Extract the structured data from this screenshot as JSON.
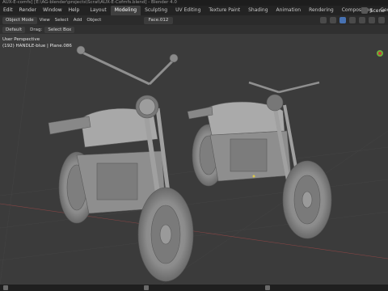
{
  "titlebar": {
    "text": "AUX-E-comfs] [E:\\AG-blender\\projects\\Scrat\\AUX-E-Cofmfs.blend] - Blender 4.0"
  },
  "menubar": {
    "items": [
      "Edit",
      "Render",
      "Window",
      "Help"
    ],
    "tabs": [
      "Layout",
      "Modeling",
      "Sculpting",
      "UV Editing",
      "Texture Paint",
      "Shading",
      "Animation",
      "Rendering",
      "Compositing",
      "Geonet"
    ],
    "active_tab": "Modeling",
    "scene_label": "Scene"
  },
  "header": {
    "mode": "Object Mode",
    "menus": [
      "View",
      "Select",
      "Add",
      "Object"
    ],
    "face_field": "Face.012"
  },
  "toolheader": {
    "orientation": "Default",
    "drag_label": "Drag:",
    "drag_value": "Select Box"
  },
  "viewport": {
    "perspective_label": "User Perspective",
    "object_info": "(192) HANDLE-blue | Plane.086"
  },
  "colors": {
    "background": "#3b3b3b",
    "accent": "#4772b3",
    "gizmo_green": "#6bb03a"
  }
}
